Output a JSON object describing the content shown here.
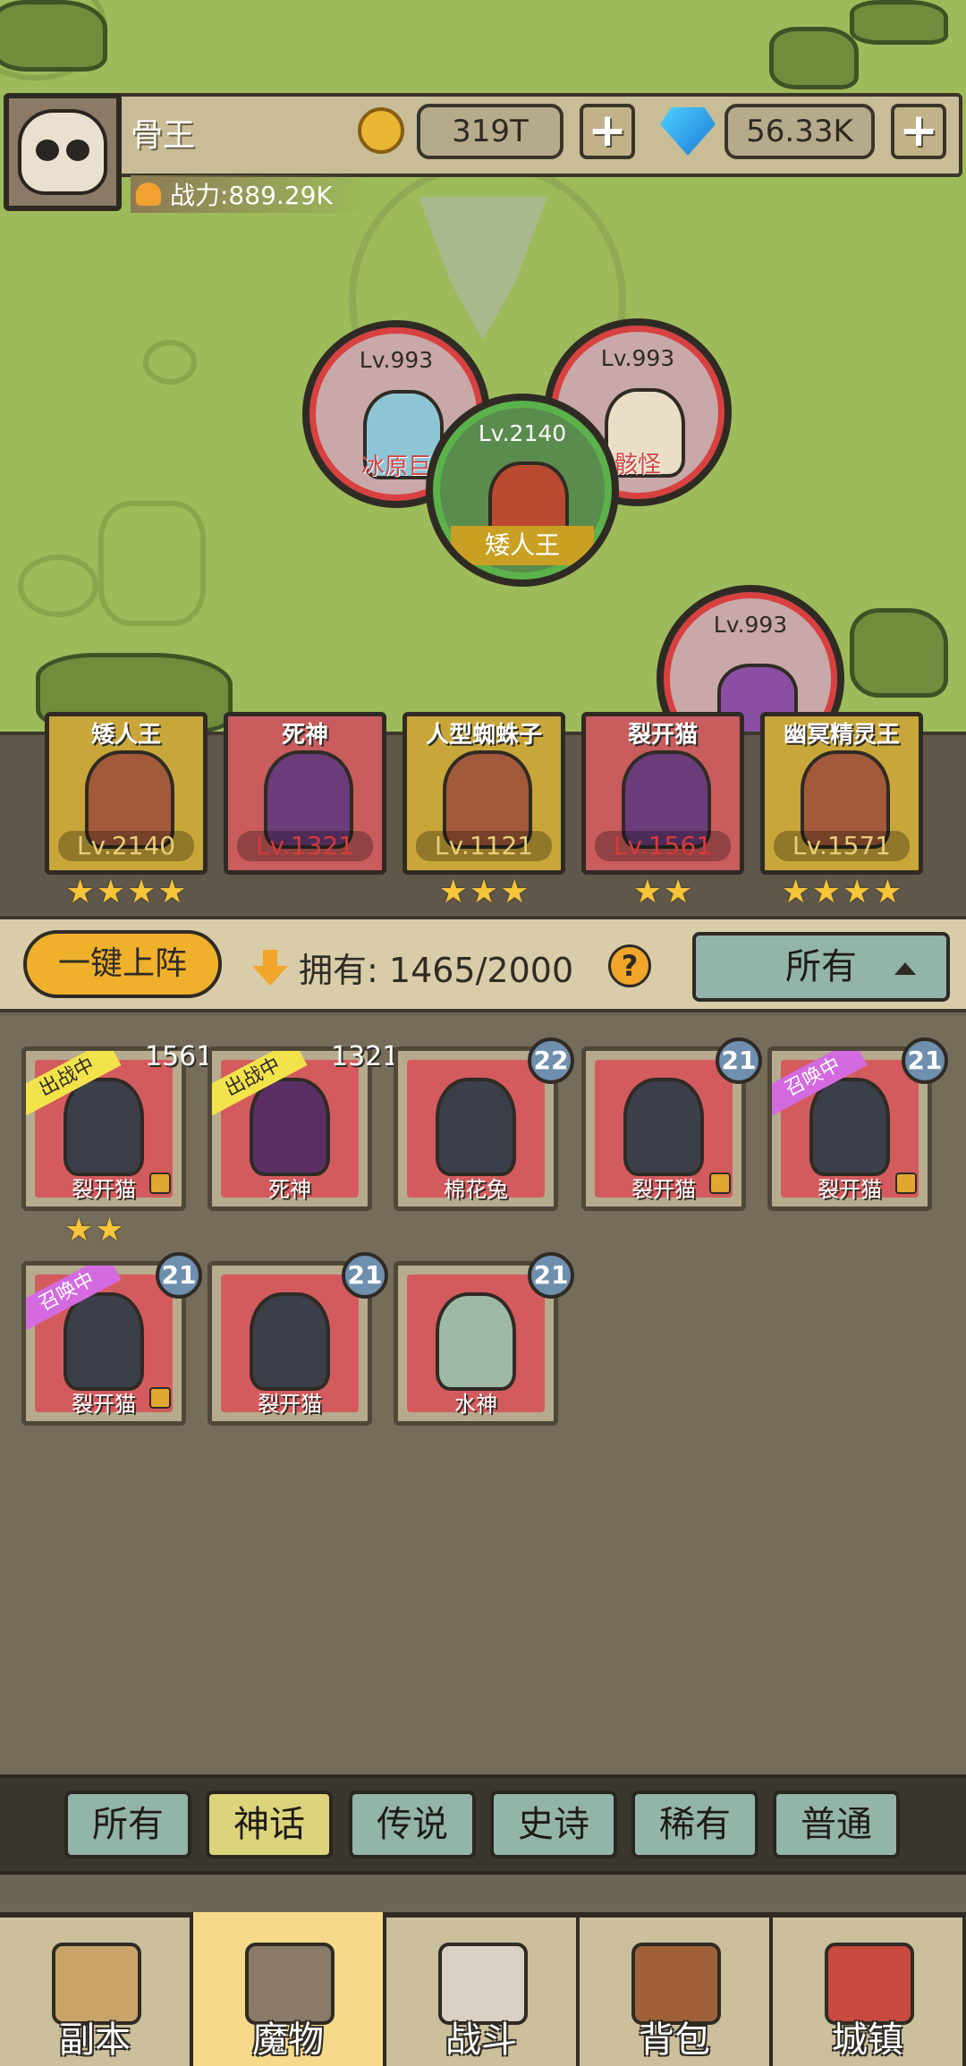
{
  "player": {
    "name": "骨王",
    "power": "战力:889.29K",
    "gold": "319T",
    "gems": "56.33K",
    "plus": "+"
  },
  "enemies": [
    {
      "level": "Lv.993",
      "name": "冰原巨"
    },
    {
      "level": "Lv.993",
      "name": "骸怪"
    },
    {
      "level": "Lv.2140",
      "name": "矮人王"
    },
    {
      "level": "Lv.993",
      "name": ""
    }
  ],
  "team": [
    {
      "name": "矮人王",
      "level": "Lv.2140",
      "stars": 4,
      "color": "#c9a63a",
      "lvcolor": "#e6cf78"
    },
    {
      "name": "死神",
      "level": "Lv.1321",
      "stars": 0,
      "color": "#c95c5c",
      "lvcolor": "#d83a3a"
    },
    {
      "name": "人型蜘蛛子",
      "level": "Lv.1121",
      "stars": 3,
      "color": "#c9a63a",
      "lvcolor": "#e6cf78"
    },
    {
      "name": "裂开猫",
      "level": "Lv.1561",
      "stars": 2,
      "color": "#c95c5c",
      "lvcolor": "#d83a3a"
    },
    {
      "name": "幽冥精灵王",
      "level": "Lv.1571",
      "stars": 4,
      "color": "#c9a63a",
      "lvcolor": "#e6cf78"
    }
  ],
  "toolbar": {
    "auto_deploy": "一键上阵",
    "owned_label": "拥有:",
    "owned_value": "1465/2000",
    "help": "?",
    "sort": "所有"
  },
  "monsters": [
    {
      "name": "裂开猫",
      "badge": "1561",
      "tag": "出战中",
      "lock": true,
      "stars": 2
    },
    {
      "name": "死神",
      "badge": "1321",
      "tag": "出战中",
      "lock": false,
      "stars": 0
    },
    {
      "name": "棉花兔",
      "badge": "22",
      "tag": "",
      "lock": false,
      "stars": 0
    },
    {
      "name": "裂开猫",
      "badge": "21",
      "tag": "",
      "lock": true,
      "stars": 0
    },
    {
      "name": "裂开猫",
      "badge": "21",
      "tag": "召唤中",
      "lock": true,
      "stars": 0
    },
    {
      "name": "裂开猫",
      "badge": "21",
      "tag": "召唤中",
      "lock": true,
      "stars": 0
    },
    {
      "name": "裂开猫",
      "badge": "21",
      "tag": "",
      "lock": false,
      "stars": 0
    },
    {
      "name": "水神",
      "badge": "21",
      "tag": "",
      "lock": false,
      "stars": 0
    }
  ],
  "rarity_tabs": [
    "所有",
    "神话",
    "传说",
    "史诗",
    "稀有",
    "普通"
  ],
  "active_rarity": "神话",
  "nav": [
    {
      "label": "副本",
      "icon": "map-icon"
    },
    {
      "label": "魔物",
      "icon": "helmet-icon"
    },
    {
      "label": "战斗",
      "icon": "swords-icon"
    },
    {
      "label": "背包",
      "icon": "backpack-icon"
    },
    {
      "label": "城镇",
      "icon": "shop-icon"
    }
  ],
  "active_nav": "魔物",
  "colors": {
    "tag_active": "#f3e34a",
    "tag_summon": "#d46ae0",
    "accent": "#efb02c"
  }
}
